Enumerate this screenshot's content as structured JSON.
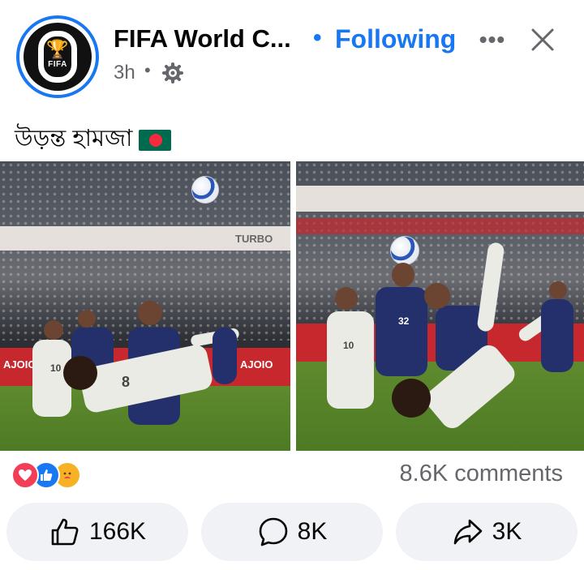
{
  "header": {
    "page_name": "FIFA World C...",
    "separator": "•",
    "follow_label": "Following",
    "more_label": "•••",
    "timestamp": "3h",
    "time_separator": "•",
    "avatar_text": "FIFA"
  },
  "post": {
    "caption": "উড়ন্ত হামজা",
    "caption_emoji": "bangladesh-flag",
    "photos": [
      {
        "name": "photo-1",
        "left_banner": "TURBO",
        "ad_text": "AJOIO"
      },
      {
        "name": "photo-2",
        "jersey_numbers": [
          "10",
          "32"
        ]
      }
    ]
  },
  "photo_labels": {
    "left_board": "TURBO",
    "left_ad_a": "AJOIO",
    "left_ad_b": "AJOIO",
    "left_num_white": "10",
    "left_num_flip": "8",
    "right_num_white": "10",
    "right_num_blue": "32"
  },
  "reactions": {
    "icons": [
      "love-icon",
      "like-icon",
      "care-icon"
    ],
    "comments_count": "8.6K comments"
  },
  "actions": {
    "like_count": "166K",
    "comment_count": "8K",
    "share_count": "3K"
  },
  "colors": {
    "accent": "#1877f2",
    "secondary_text": "#65676b",
    "button_bg": "#f0f2f5",
    "love": "#f33e58",
    "care": "#f7b125"
  }
}
